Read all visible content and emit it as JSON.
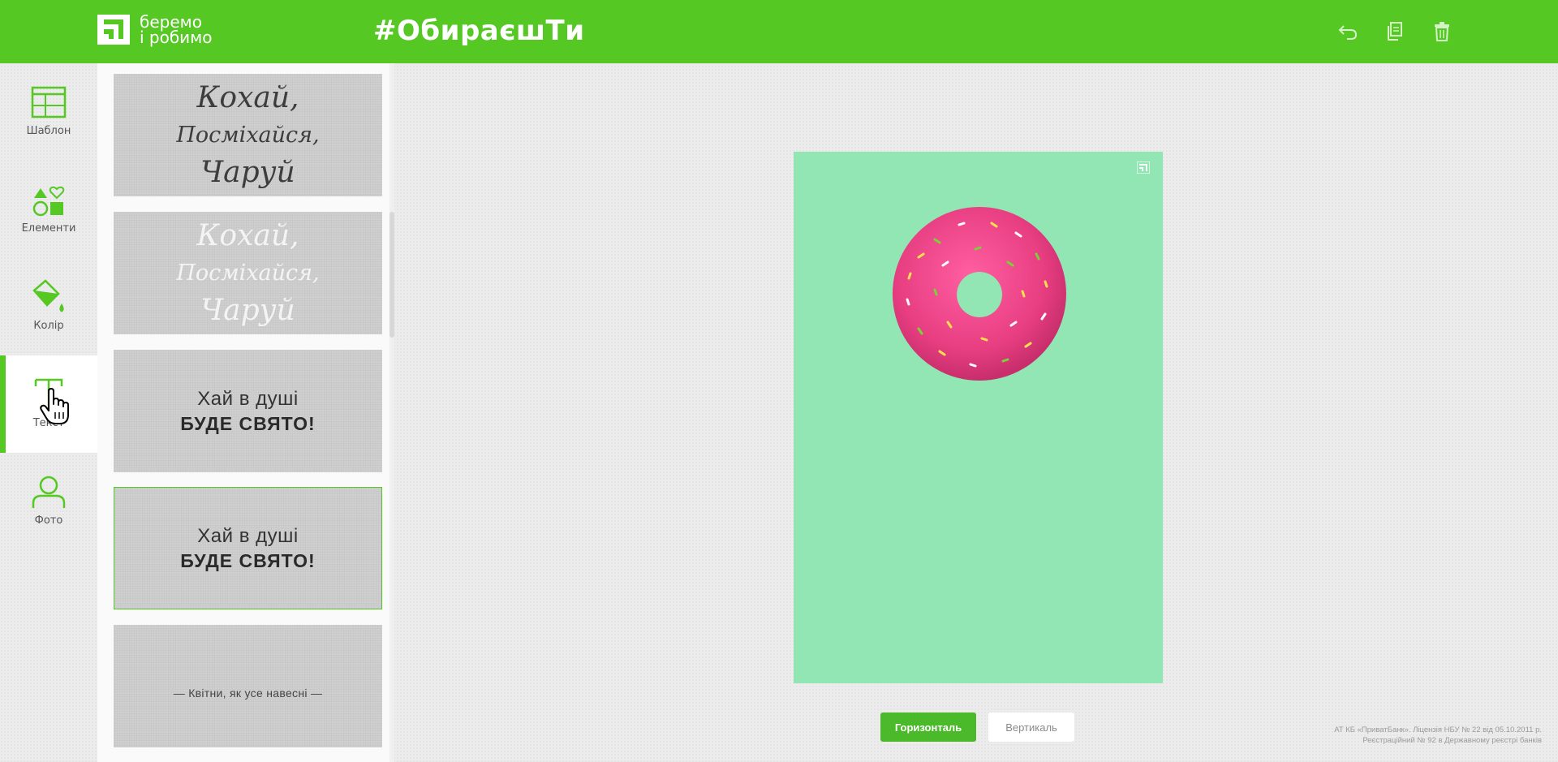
{
  "header": {
    "logo_line1": "беремо",
    "logo_line2": "і робимо",
    "hashtag": "#ОбираєшТи",
    "actions": [
      {
        "icon": "undo-icon"
      },
      {
        "icon": "copy-icon"
      },
      {
        "icon": "trash-icon"
      }
    ]
  },
  "rail": {
    "items": [
      {
        "label": "Шаблон",
        "icon": "template-icon"
      },
      {
        "label": "Елементи",
        "icon": "elements-icon"
      },
      {
        "label": "Колір",
        "icon": "paint-bucket-icon"
      },
      {
        "label": "Текст",
        "icon": "text-icon",
        "active": true
      },
      {
        "label": "Фото",
        "icon": "user-photo-icon"
      }
    ]
  },
  "panel": {
    "cards": [
      {
        "lines": [
          "Кохай,",
          "Посміхайся,",
          "Чаруй"
        ]
      },
      {
        "lines": [
          "Кохай,",
          "Посміхайся,",
          "Чаруй"
        ]
      },
      {
        "line1": "Хай в душі",
        "line2": "БУДЕ СВЯТО!"
      },
      {
        "line1": "Хай в душі",
        "line2": "БУДЕ СВЯТО!",
        "selected": true
      },
      {
        "line1": "— Квітни, як усе навесні —"
      }
    ]
  },
  "canvas": {
    "background": "#91e6b3"
  },
  "buttons": {
    "horizontal": "Горизонталь",
    "vertical": "Вертикаль"
  },
  "legal": {
    "line1": "АТ КБ «ПриватБанк». Ліцензія НБУ № 22 від 05.10.2011 р.",
    "line2": "Реєстраційний № 92 в Державному реєстрі банків"
  },
  "colors": {
    "brand_green": "#55c823",
    "button_green": "#4bba2a"
  }
}
